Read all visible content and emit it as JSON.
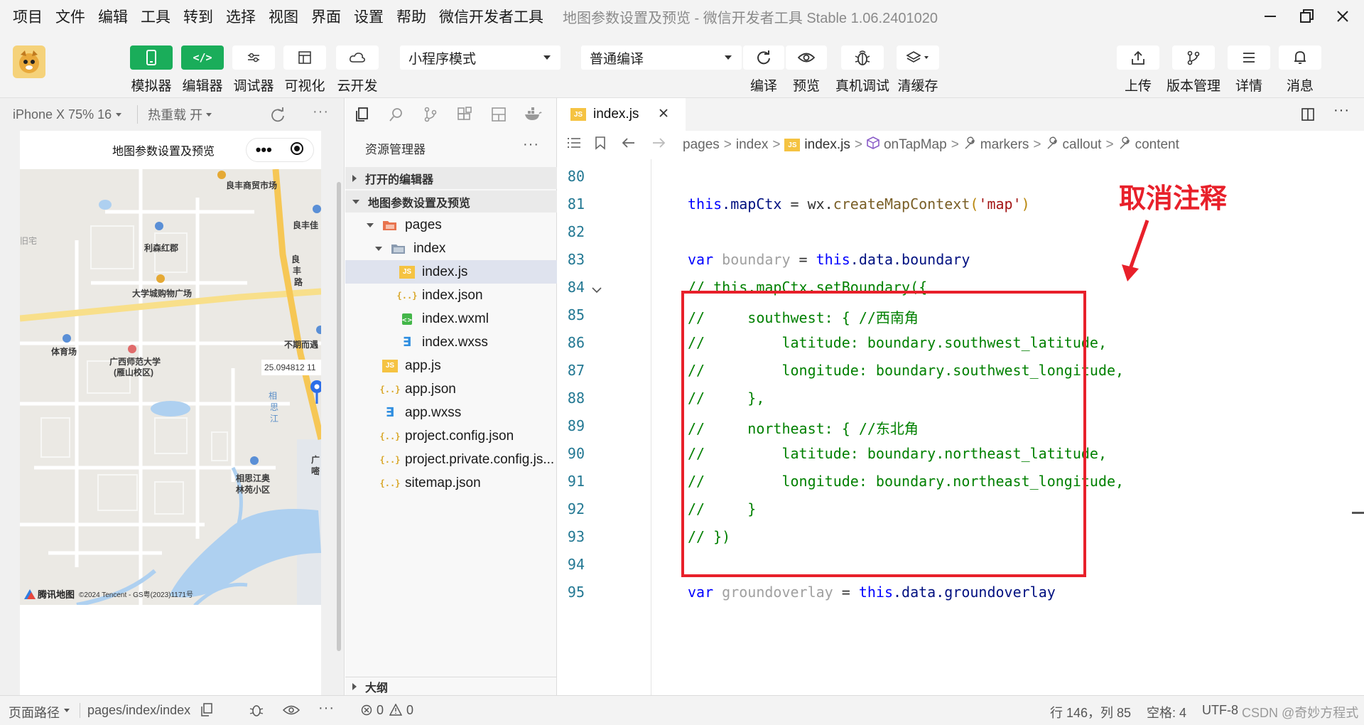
{
  "menu": [
    "项目",
    "文件",
    "编辑",
    "工具",
    "转到",
    "选择",
    "视图",
    "界面",
    "设置",
    "帮助",
    "微信开发者工具"
  ],
  "window_title": "地图参数设置及预览 - 微信开发者工具 Stable 1.06.2401020",
  "toolbar": {
    "simulator": "模拟器",
    "editor": "编辑器",
    "debugger": "调试器",
    "visual": "可视化",
    "cloud": "云开发",
    "mode_select": "小程序模式",
    "compile_select": "普通编译",
    "compile": "编译",
    "preview": "预览",
    "real_debug": "真机调试",
    "clear_cache": "清缓存",
    "upload": "上传",
    "version": "版本管理",
    "details": "详情",
    "messages": "消息"
  },
  "simulator": {
    "device": "iPhone X 75% 16",
    "hot_reload": "热重载 开",
    "page_title": "地图参数设置及预览",
    "map_labels": {
      "l1": "良丰商贸市场",
      "l2": "良丰佳",
      "l3": "利森红郡",
      "l4": "大学城购物广场",
      "l5": "良",
      "l6": "丰",
      "l7": "路",
      "l8": "体育场",
      "l9": "广西师范大学",
      "l10": "(雁山校区)",
      "l11": "不期而遇",
      "l12": "25.094812 11",
      "l13": "相",
      "l14": "思",
      "l15": "江",
      "l16": "相思江奥",
      "l17": "林苑小区",
      "l18": "旧宅",
      "l19": "广",
      "l20": "嘧"
    },
    "map_brand": "腾讯地图",
    "map_copyright": "©2024 Tencent - GS粤(2023)1171号"
  },
  "explorer": {
    "title": "资源管理器",
    "open_editors": "打开的编辑器",
    "project": "地图参数设置及预览",
    "tree": [
      {
        "name": "pages",
        "type": "folder-open"
      },
      {
        "name": "index",
        "type": "folder-open"
      },
      {
        "name": "index.js",
        "type": "js"
      },
      {
        "name": "index.json",
        "type": "json"
      },
      {
        "name": "index.wxml",
        "type": "wxml"
      },
      {
        "name": "index.wxss",
        "type": "wxss"
      },
      {
        "name": "app.js",
        "type": "js"
      },
      {
        "name": "app.json",
        "type": "json"
      },
      {
        "name": "app.wxss",
        "type": "wxss"
      },
      {
        "name": "project.config.json",
        "type": "json"
      },
      {
        "name": "project.private.config.js...",
        "type": "json"
      },
      {
        "name": "sitemap.json",
        "type": "json"
      }
    ],
    "outline": "大纲"
  },
  "editor": {
    "tab": "index.js",
    "breadcrumb": [
      "pages",
      "index",
      "index.js",
      "onTapMap",
      "markers",
      "callout",
      "content"
    ],
    "annotation": "取消注释",
    "line_numbers": [
      "80",
      "81",
      "82",
      "83",
      "84",
      "85",
      "86",
      "87",
      "88",
      "89",
      "90",
      "91",
      "92",
      "93",
      "94",
      "95"
    ],
    "code": {
      "l81": {
        "this": "this",
        "prop": ".mapCtx",
        "eq": " = wx.",
        "fn": "createMapContext",
        "open": "(",
        "str": "'map'",
        "close": ")"
      },
      "l83": {
        "var": "var",
        "name": " boundary",
        "eq": " = ",
        "this": "this",
        "rest": ".data.boundary"
      },
      "l84": "// this.mapCtx.setBoundary({",
      "l85": "//     southwest: { //西南角",
      "l86": "//         latitude: boundary.southwest_latitude,",
      "l87": "//         longitude: boundary.southwest_longitude,",
      "l88": "//     },",
      "l89": "//     northeast: { //东北角",
      "l90": "//         latitude: boundary.northeast_latitude,",
      "l91": "//         longitude: boundary.northeast_longitude,",
      "l92": "//     }",
      "l93": "// })",
      "l95": {
        "var": "var",
        "name": " groundoverlay",
        "eq": " = ",
        "this": "this",
        "rest": ".data.groundoverlay"
      }
    }
  },
  "status": {
    "page_path_label": "页面路径",
    "page_path": "pages/index/index",
    "errors": "0",
    "warnings": "0",
    "cursor": "行 146，列 85",
    "spaces": "空格: 4",
    "encoding": "UTF-8",
    "watermark": "CSDN @奇妙方程式"
  },
  "colors": {
    "accent_green": "#1aad5a",
    "annotation_red": "#e8202a",
    "comment_green": "#008000",
    "keyword_blue": "#0000ff"
  }
}
